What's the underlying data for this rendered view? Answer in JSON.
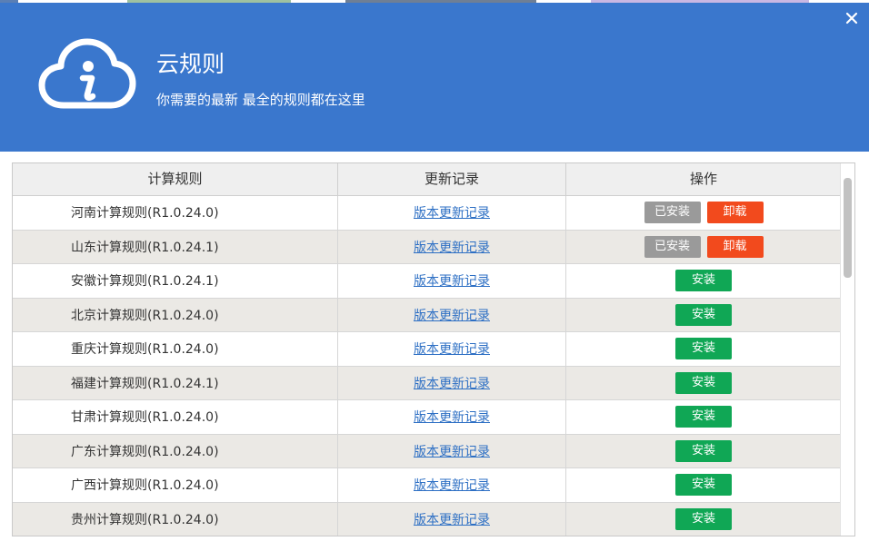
{
  "dialog": {
    "title": "云规则",
    "subtitle": "你需要的最新 最全的规则都在这里",
    "close_icon": "close-icon",
    "logo_icon": "cloud-info-icon",
    "accent_color": "#3a77cd"
  },
  "table": {
    "headers": [
      "计算规则",
      "更新记录",
      "操作"
    ],
    "rows": [
      {
        "name": "河南计算规则(R1.0.24.0)",
        "link": "版本更新记录",
        "actions": [
          "已安装",
          "卸载"
        ]
      },
      {
        "name": "山东计算规则(R1.0.24.1)",
        "link": "版本更新记录",
        "actions": [
          "已安装",
          "卸载"
        ]
      },
      {
        "name": "安徽计算规则(R1.0.24.1)",
        "link": "版本更新记录",
        "actions": [
          "安装"
        ]
      },
      {
        "name": "北京计算规则(R1.0.24.0)",
        "link": "版本更新记录",
        "actions": [
          "安装"
        ]
      },
      {
        "name": "重庆计算规则(R1.0.24.0)",
        "link": "版本更新记录",
        "actions": [
          "安装"
        ]
      },
      {
        "name": "福建计算规则(R1.0.24.1)",
        "link": "版本更新记录",
        "actions": [
          "安装"
        ]
      },
      {
        "name": "甘肃计算规则(R1.0.24.0)",
        "link": "版本更新记录",
        "actions": [
          "安装"
        ]
      },
      {
        "name": "广东计算规则(R1.0.24.0)",
        "link": "版本更新记录",
        "actions": [
          "安装"
        ]
      },
      {
        "name": "广西计算规则(R1.0.24.0)",
        "link": "版本更新记录",
        "actions": [
          "安装"
        ]
      },
      {
        "name": "贵州计算规则(R1.0.24.0)",
        "link": "版本更新记录",
        "actions": [
          "安装"
        ]
      }
    ]
  },
  "colors": {
    "installed_button": "#9a9a9a",
    "uninstall_button": "#f24a1d",
    "install_button": "#10a755",
    "link": "#2d6fc4"
  }
}
